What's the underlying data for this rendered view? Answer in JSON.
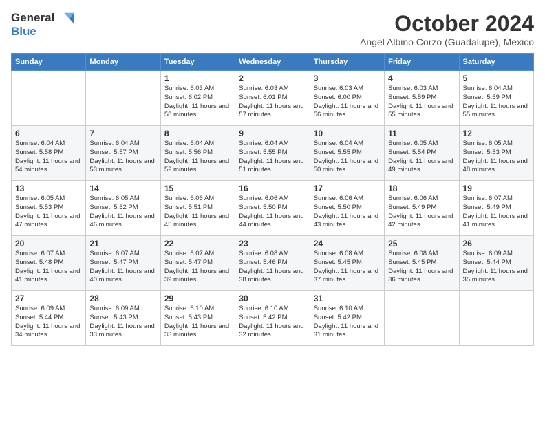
{
  "header": {
    "logo_general": "General",
    "logo_blue": "Blue",
    "month_title": "October 2024",
    "subtitle": "Angel Albino Corzo (Guadalupe), Mexico"
  },
  "days_of_week": [
    "Sunday",
    "Monday",
    "Tuesday",
    "Wednesday",
    "Thursday",
    "Friday",
    "Saturday"
  ],
  "weeks": [
    [
      {
        "day": "",
        "sunrise": "",
        "sunset": "",
        "daylight": ""
      },
      {
        "day": "",
        "sunrise": "",
        "sunset": "",
        "daylight": ""
      },
      {
        "day": "1",
        "sunrise": "Sunrise: 6:03 AM",
        "sunset": "Sunset: 6:02 PM",
        "daylight": "Daylight: 11 hours and 58 minutes."
      },
      {
        "day": "2",
        "sunrise": "Sunrise: 6:03 AM",
        "sunset": "Sunset: 6:01 PM",
        "daylight": "Daylight: 11 hours and 57 minutes."
      },
      {
        "day": "3",
        "sunrise": "Sunrise: 6:03 AM",
        "sunset": "Sunset: 6:00 PM",
        "daylight": "Daylight: 11 hours and 56 minutes."
      },
      {
        "day": "4",
        "sunrise": "Sunrise: 6:03 AM",
        "sunset": "Sunset: 5:59 PM",
        "daylight": "Daylight: 11 hours and 55 minutes."
      },
      {
        "day": "5",
        "sunrise": "Sunrise: 6:04 AM",
        "sunset": "Sunset: 5:59 PM",
        "daylight": "Daylight: 11 hours and 55 minutes."
      }
    ],
    [
      {
        "day": "6",
        "sunrise": "Sunrise: 6:04 AM",
        "sunset": "Sunset: 5:58 PM",
        "daylight": "Daylight: 11 hours and 54 minutes."
      },
      {
        "day": "7",
        "sunrise": "Sunrise: 6:04 AM",
        "sunset": "Sunset: 5:57 PM",
        "daylight": "Daylight: 11 hours and 53 minutes."
      },
      {
        "day": "8",
        "sunrise": "Sunrise: 6:04 AM",
        "sunset": "Sunset: 5:56 PM",
        "daylight": "Daylight: 11 hours and 52 minutes."
      },
      {
        "day": "9",
        "sunrise": "Sunrise: 6:04 AM",
        "sunset": "Sunset: 5:55 PM",
        "daylight": "Daylight: 11 hours and 51 minutes."
      },
      {
        "day": "10",
        "sunrise": "Sunrise: 6:04 AM",
        "sunset": "Sunset: 5:55 PM",
        "daylight": "Daylight: 11 hours and 50 minutes."
      },
      {
        "day": "11",
        "sunrise": "Sunrise: 6:05 AM",
        "sunset": "Sunset: 5:54 PM",
        "daylight": "Daylight: 11 hours and 49 minutes."
      },
      {
        "day": "12",
        "sunrise": "Sunrise: 6:05 AM",
        "sunset": "Sunset: 5:53 PM",
        "daylight": "Daylight: 11 hours and 48 minutes."
      }
    ],
    [
      {
        "day": "13",
        "sunrise": "Sunrise: 6:05 AM",
        "sunset": "Sunset: 5:53 PM",
        "daylight": "Daylight: 11 hours and 47 minutes."
      },
      {
        "day": "14",
        "sunrise": "Sunrise: 6:05 AM",
        "sunset": "Sunset: 5:52 PM",
        "daylight": "Daylight: 11 hours and 46 minutes."
      },
      {
        "day": "15",
        "sunrise": "Sunrise: 6:06 AM",
        "sunset": "Sunset: 5:51 PM",
        "daylight": "Daylight: 11 hours and 45 minutes."
      },
      {
        "day": "16",
        "sunrise": "Sunrise: 6:06 AM",
        "sunset": "Sunset: 5:50 PM",
        "daylight": "Daylight: 11 hours and 44 minutes."
      },
      {
        "day": "17",
        "sunrise": "Sunrise: 6:06 AM",
        "sunset": "Sunset: 5:50 PM",
        "daylight": "Daylight: 11 hours and 43 minutes."
      },
      {
        "day": "18",
        "sunrise": "Sunrise: 6:06 AM",
        "sunset": "Sunset: 5:49 PM",
        "daylight": "Daylight: 11 hours and 42 minutes."
      },
      {
        "day": "19",
        "sunrise": "Sunrise: 6:07 AM",
        "sunset": "Sunset: 5:49 PM",
        "daylight": "Daylight: 11 hours and 41 minutes."
      }
    ],
    [
      {
        "day": "20",
        "sunrise": "Sunrise: 6:07 AM",
        "sunset": "Sunset: 5:48 PM",
        "daylight": "Daylight: 11 hours and 41 minutes."
      },
      {
        "day": "21",
        "sunrise": "Sunrise: 6:07 AM",
        "sunset": "Sunset: 5:47 PM",
        "daylight": "Daylight: 11 hours and 40 minutes."
      },
      {
        "day": "22",
        "sunrise": "Sunrise: 6:07 AM",
        "sunset": "Sunset: 5:47 PM",
        "daylight": "Daylight: 11 hours and 39 minutes."
      },
      {
        "day": "23",
        "sunrise": "Sunrise: 6:08 AM",
        "sunset": "Sunset: 5:46 PM",
        "daylight": "Daylight: 11 hours and 38 minutes."
      },
      {
        "day": "24",
        "sunrise": "Sunrise: 6:08 AM",
        "sunset": "Sunset: 5:45 PM",
        "daylight": "Daylight: 11 hours and 37 minutes."
      },
      {
        "day": "25",
        "sunrise": "Sunrise: 6:08 AM",
        "sunset": "Sunset: 5:45 PM",
        "daylight": "Daylight: 11 hours and 36 minutes."
      },
      {
        "day": "26",
        "sunrise": "Sunrise: 6:09 AM",
        "sunset": "Sunset: 5:44 PM",
        "daylight": "Daylight: 11 hours and 35 minutes."
      }
    ],
    [
      {
        "day": "27",
        "sunrise": "Sunrise: 6:09 AM",
        "sunset": "Sunset: 5:44 PM",
        "daylight": "Daylight: 11 hours and 34 minutes."
      },
      {
        "day": "28",
        "sunrise": "Sunrise: 6:09 AM",
        "sunset": "Sunset: 5:43 PM",
        "daylight": "Daylight: 11 hours and 33 minutes."
      },
      {
        "day": "29",
        "sunrise": "Sunrise: 6:10 AM",
        "sunset": "Sunset: 5:43 PM",
        "daylight": "Daylight: 11 hours and 33 minutes."
      },
      {
        "day": "30",
        "sunrise": "Sunrise: 6:10 AM",
        "sunset": "Sunset: 5:42 PM",
        "daylight": "Daylight: 11 hours and 32 minutes."
      },
      {
        "day": "31",
        "sunrise": "Sunrise: 6:10 AM",
        "sunset": "Sunset: 5:42 PM",
        "daylight": "Daylight: 11 hours and 31 minutes."
      },
      {
        "day": "",
        "sunrise": "",
        "sunset": "",
        "daylight": ""
      },
      {
        "day": "",
        "sunrise": "",
        "sunset": "",
        "daylight": ""
      }
    ]
  ]
}
